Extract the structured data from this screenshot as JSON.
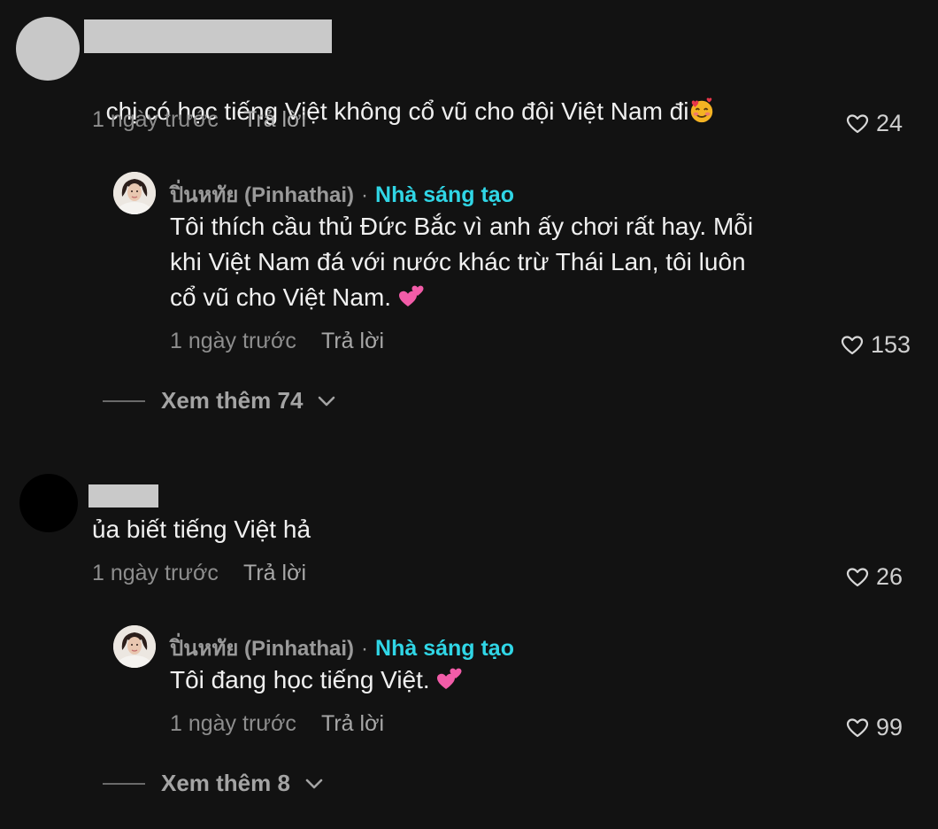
{
  "comments": [
    {
      "text": "chị có học tiếng Việt không cổ vũ cho đội Việt Nam đi",
      "emoji": "smiling-face-with-hearts",
      "time": "1 ngày trước",
      "reply_label": "Trả lời",
      "likes": "24",
      "reply": {
        "author": "ปิ่นหทัย (Pinhathai)",
        "dot": "·",
        "badge": "Nhà sáng tạo",
        "text": "Tôi thích cầu thủ Đức Bắc vì anh ấy chơi rất hay. Mỗi\nkhi Việt Nam đá với nước khác trừ Thái Lan, tôi luôn\ncổ vũ cho Việt Nam. ",
        "emoji": "two-hearts",
        "time": "1 ngày trước",
        "reply_label": "Trả lời",
        "likes": "153"
      },
      "view_more": "Xem thêm 74"
    },
    {
      "text": "ủa biết tiếng Việt hả",
      "time": "1 ngày trước",
      "reply_label": "Trả lời",
      "likes": "26",
      "reply": {
        "author": "ปิ่นหทัย (Pinhathai)",
        "dot": "·",
        "badge": "Nhà sáng tạo",
        "text": "Tôi đang học tiếng Việt. ",
        "emoji": "two-hearts",
        "time": "1 ngày trước",
        "reply_label": "Trả lời",
        "likes": "99"
      },
      "view_more": "Xem thêm 8"
    }
  ],
  "colors": {
    "background": "#121212",
    "creator_badge": "#30d6e6",
    "avatar_1": "#c8c8c8",
    "avatar_2": "#000000"
  }
}
